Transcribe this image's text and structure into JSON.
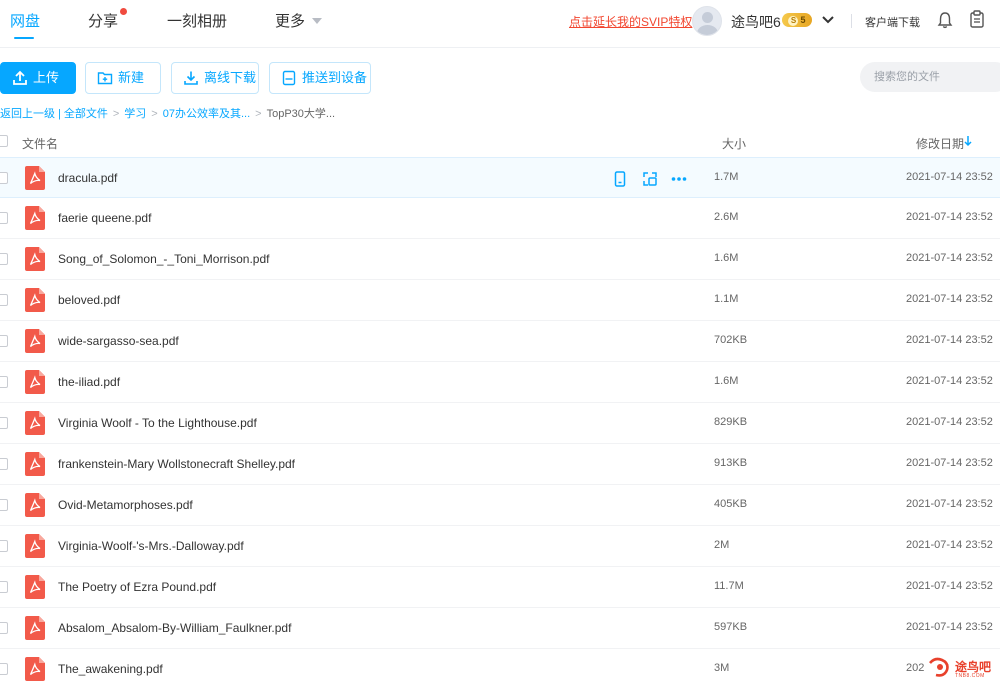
{
  "nav": {
    "tabs": [
      {
        "label": "网盘"
      },
      {
        "label": "分享"
      },
      {
        "label": "一刻相册"
      },
      {
        "label": "更多"
      }
    ],
    "svip_link": "点击延长我的SVIP特权",
    "username": "途鸟吧6",
    "svip_level": "5",
    "client_download": "客户端下载"
  },
  "toolbar": {
    "upload": "上传",
    "new": "新建",
    "offline_download": "离线下载",
    "push_to_device": "推送到设备",
    "search_placeholder": "搜索您的文件"
  },
  "breadcrumb": {
    "back": "返回上一级",
    "items": [
      "全部文件",
      "学习",
      "07办公效率及其...",
      "TopP30大学..."
    ]
  },
  "list": {
    "headers": {
      "name": "文件名",
      "size": "大小",
      "modified": "修改日期"
    },
    "rows": [
      {
        "name": "dracula.pdf",
        "size": "1.7M",
        "date": "2021-07-14 23:52"
      },
      {
        "name": "faerie queene.pdf",
        "size": "2.6M",
        "date": "2021-07-14 23:52"
      },
      {
        "name": "Song_of_Solomon_-_Toni_Morrison.pdf",
        "size": "1.6M",
        "date": "2021-07-14 23:52"
      },
      {
        "name": "beloved.pdf",
        "size": "1.1M",
        "date": "2021-07-14 23:52"
      },
      {
        "name": "wide-sargasso-sea.pdf",
        "size": "702KB",
        "date": "2021-07-14 23:52"
      },
      {
        "name": "the-iliad.pdf",
        "size": "1.6M",
        "date": "2021-07-14 23:52"
      },
      {
        "name": "Virginia Woolf - To the Lighthouse.pdf",
        "size": "829KB",
        "date": "2021-07-14 23:52"
      },
      {
        "name": "frankenstein-Mary Wollstonecraft Shelley.pdf",
        "size": "913KB",
        "date": "2021-07-14 23:52"
      },
      {
        "name": "Ovid-Metamorphoses.pdf",
        "size": "405KB",
        "date": "2021-07-14 23:52"
      },
      {
        "name": "Virginia-Woolf-'s-Mrs.-Dalloway.pdf",
        "size": "2M",
        "date": "2021-07-14 23:52"
      },
      {
        "name": "The Poetry of Ezra Pound.pdf",
        "size": "11.7M",
        "date": "2021-07-14 23:52"
      },
      {
        "name": "Absalom_Absalom-By-William_Faulkner.pdf",
        "size": "597KB",
        "date": "2021-07-14 23:52"
      },
      {
        "name": "The_awakening.pdf",
        "size": "3M",
        "date": "202"
      }
    ]
  },
  "watermark": {
    "text": "途鸟吧",
    "sub": "TNB8.COM"
  },
  "colors": {
    "accent": "#06a7ff",
    "pdf_red": "#f25a4a",
    "link_red": "#f2462f"
  }
}
